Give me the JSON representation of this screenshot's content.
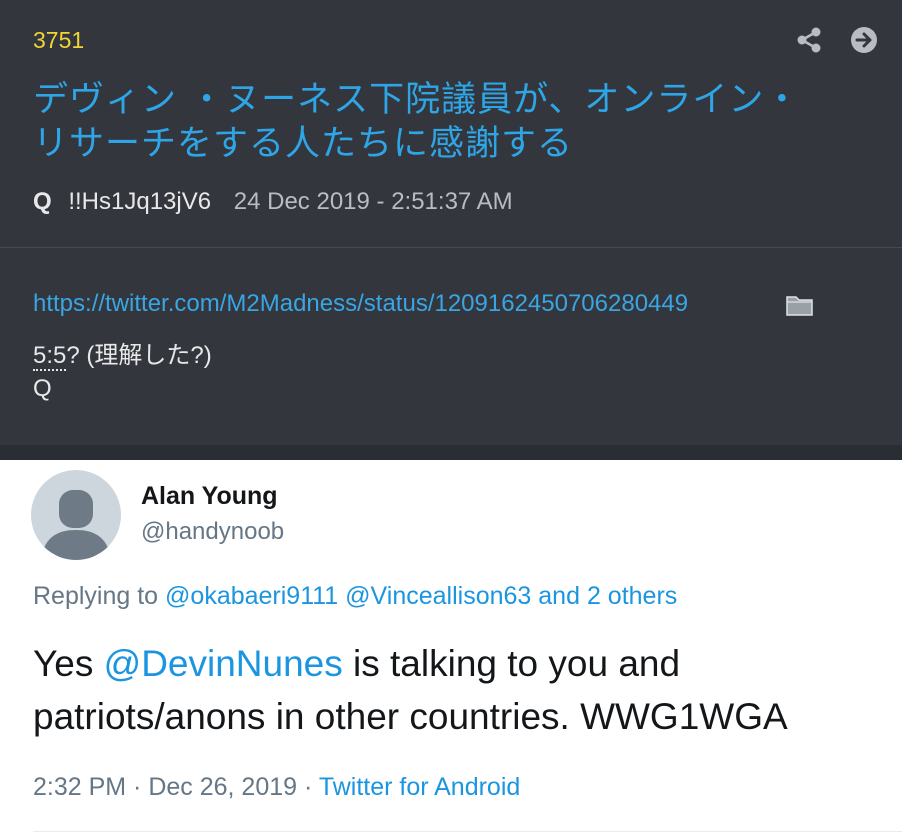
{
  "post": {
    "number": "3751",
    "title_line1": "デヴィン ・ヌーネス下院議員が、オンライン・",
    "title_line2": "リサーチをする人たちに感謝する",
    "author": "Q",
    "tripcode": "!!Hs1Jq13jV6",
    "date": "24 Dec 2019 - 2:51:37 AM",
    "link": "https://twitter.com/M2Madness/status/1209162450706280449",
    "note_code": "5:5",
    "note_rest": "? (理解した?)",
    "signature": "Q",
    "icons": {
      "share": "share-icon",
      "open": "arrow-right-circle-icon",
      "attachment": "folder-icon"
    },
    "colors": {
      "background": "#33363d",
      "number": "#f2d434",
      "link": "#2ea5e6"
    }
  },
  "tweet": {
    "name": "Alan Young",
    "handle": "@handynoob",
    "replying_prefix": "Replying to ",
    "reply_mention1": "@okabaeri9111",
    "reply_mention2": "@Vinceallison63",
    "reply_others": "and 2 others",
    "text_pre": "Yes ",
    "text_mention": "@DevinNunes",
    "text_line1_rest": " is talking to you and",
    "text_line2": "patriots/anons in other countries. WWG1WGA",
    "time": "2:32 PM · Dec 26, 2019 · ",
    "source": "Twitter for Android",
    "colors": {
      "link": "#1b95e0",
      "muted": "#657786"
    }
  }
}
